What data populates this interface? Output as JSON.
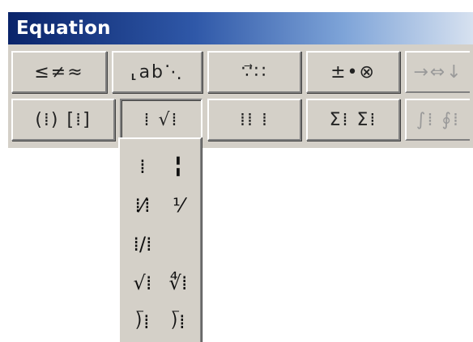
{
  "window": {
    "title": "Equation"
  },
  "toolbar": {
    "row1": [
      {
        "name": "relational-symbols-palette",
        "glyphs": "≤≠≈"
      },
      {
        "name": "spaces-ellipses-palette",
        "glyphs": "⸤ab⋱"
      },
      {
        "name": "embellishments-palette",
        "glyphs": "∵⃗∷"
      },
      {
        "name": "operator-symbols-palette",
        "glyphs": "±•⊗"
      },
      {
        "name": "arrow-symbols-palette",
        "glyphs": "→⇔↓"
      }
    ],
    "row2": [
      {
        "name": "fence-templates-palette",
        "glyphs": "(⁞) [⁞]"
      },
      {
        "name": "fraction-radical-templates-palette",
        "glyphs": "⁞ √⁞"
      },
      {
        "name": "subscript-superscript-templates-palette",
        "glyphs": "⁞⁞ ⁞"
      },
      {
        "name": "summation-templates-palette",
        "glyphs": "Σ⁞ Σ⁞"
      },
      {
        "name": "integral-templates-palette",
        "glyphs": "∫⁞ ∮⁞"
      }
    ]
  },
  "dropdown": {
    "items": [
      {
        "name": "full-size-fraction-template",
        "glyph": "⁞"
      },
      {
        "name": "reduced-size-fraction-template",
        "glyph": "╏"
      },
      {
        "name": "slash-fraction-template",
        "glyph": "⁞⁄⁞"
      },
      {
        "name": "reduced-slash-fraction-template",
        "glyph": "⅟"
      },
      {
        "name": "inline-slash-fraction-template",
        "glyph": "⁞/⁞"
      },
      {
        "name": "empty-cell",
        "glyph": ""
      },
      {
        "name": "square-root-template",
        "glyph": "√⁞"
      },
      {
        "name": "nth-root-template",
        "glyph": "∜⁞"
      },
      {
        "name": "long-division-template",
        "glyph": "⟌⁞"
      },
      {
        "name": "long-division-with-quotient-template",
        "glyph": "⟌⁞"
      }
    ]
  },
  "colors": {
    "titlebar_start": "#0a246a",
    "titlebar_end": "#d8e2f0",
    "face": "#d4d0c8"
  }
}
